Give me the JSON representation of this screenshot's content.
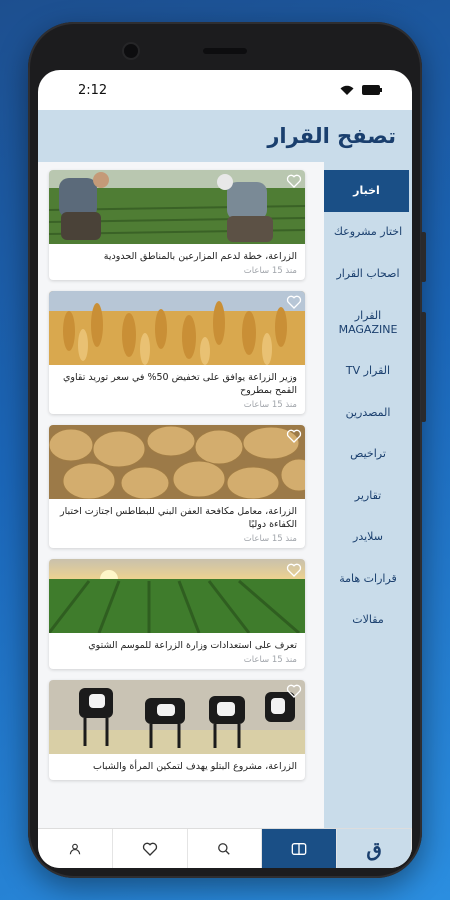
{
  "status_bar": {
    "time": "2:12"
  },
  "header": {
    "title": "تصفح القرار"
  },
  "sidebar": {
    "items": [
      {
        "label": "اخبار",
        "active": true
      },
      {
        "label": "اختار مشروعك"
      },
      {
        "label": "اصحاب القرار"
      },
      {
        "label": "القرار MAGAZINE"
      },
      {
        "label": "القرار TV"
      },
      {
        "label": "المصدرين"
      },
      {
        "label": "تراخيص"
      },
      {
        "label": "تقارير"
      },
      {
        "label": "سلايدر"
      },
      {
        "label": "قرارات هامة"
      },
      {
        "label": "مقالات"
      }
    ]
  },
  "news": [
    {
      "title": "الزراعة، خطة لدعم المزارعين بالمناطق الحدودية",
      "time": "منذ 15 ساعات",
      "image": "farmers-field"
    },
    {
      "title": "وزير الزراعة يوافق على تخفيض 50% في سعر توريد تقاوي القمح بمطروح",
      "time": "منذ 15 ساعات",
      "image": "wheat"
    },
    {
      "title": "الزراعة، معامل مكافحة العفن البني للبطاطس اجتازت اختبار الكفاءة دوليًا",
      "time": "منذ 15 ساعات",
      "image": "potatoes"
    },
    {
      "title": "تعرف على استعدادات وزارة الزراعة للموسم الشتوي",
      "time": "منذ 15 ساعات",
      "image": "sunset-field"
    },
    {
      "title": "الزراعة، مشروع البتلو يهدف لتمكين المرأة والشباب",
      "time": "",
      "image": "cows"
    }
  ],
  "bottom_nav": {
    "logo_glyph": "ق"
  },
  "colors": {
    "accent": "#1a4f86",
    "sidebar_bg": "#c9dcea",
    "header_text": "#1a3f6e"
  }
}
